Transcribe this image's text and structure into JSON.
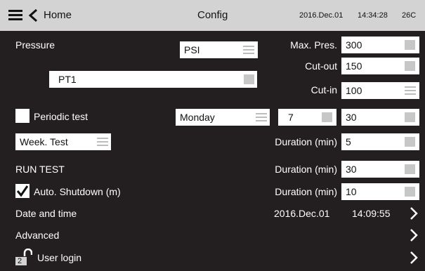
{
  "header": {
    "home_label": "Home",
    "title": "Config",
    "date": "2016.Dec.01",
    "time": "14:34:28",
    "temp": "26C",
    "bg_color": "#d3d3d3"
  },
  "pressure": {
    "label": "Pressure",
    "unit": "PSI",
    "sensor": "PT1",
    "max_label": "Max. Pres.",
    "max_value": "300",
    "cutout_label": "Cut-out",
    "cutout_value": "150",
    "cutin_label": "Cut-in",
    "cutin_value": "100"
  },
  "periodic": {
    "label": "Periodic test",
    "checked": false,
    "day": "Monday",
    "number": "7",
    "value": "30",
    "mode": "Week. Test",
    "duration_label": "Duration (min)",
    "duration_value": "5"
  },
  "run_test": {
    "label": "RUN TEST",
    "duration_label": "Duration (min)",
    "duration_value": "30"
  },
  "auto_shutdown": {
    "label": "Auto. Shutdown (m)",
    "checked": true,
    "duration_label": "Duration (min)",
    "duration_value": "10"
  },
  "date_time": {
    "label": "Date and time",
    "date": "2016.Dec.01",
    "time": "14:09:55"
  },
  "advanced": {
    "label": "Advanced"
  },
  "user_login": {
    "label": "User login",
    "badge": "2"
  },
  "icons": [
    "menu-icon",
    "back-chevron-icon",
    "list-icon",
    "slider-handle-icon",
    "checkmark-icon",
    "chevron-right-icon",
    "unlock-icon"
  ]
}
